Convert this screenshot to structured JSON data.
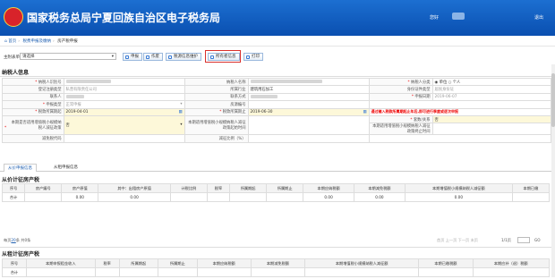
{
  "header": {
    "title": "国家税务总局宁夏回族自治区电子税务局",
    "user_prefix": "您好",
    "logout": "退出"
  },
  "breadcrumb": {
    "home": "首页",
    "module": "税费申报及缴纳",
    "page": "房产税申报"
  },
  "toolbar": {
    "label": "主附表单",
    "select_value": "请选择",
    "buttons": [
      "申报",
      "作废",
      "税源信息维护",
      "所有者信息",
      "打印"
    ]
  },
  "taxpayer": {
    "section_title": "纳税人信息",
    "labels": {
      "taxpayer_id": "纳税人识别号",
      "taxpayer_name": "纳税人名称",
      "taxpayer_category": "纳税人分类",
      "reg_type": "登记注册类型",
      "industry": "所属行业",
      "id_type": "身份证件类型",
      "contact": "联系人",
      "contact_phone": "联系方式",
      "filing_date": "申报日期",
      "reporter_type": "申报类型",
      "property_id": "房源编号",
      "period_start": "税款所属期起",
      "period_end": "税款所属期止",
      "hint": "通过输入税款所属期起止年后,即可进行季度或逐次申报",
      "relation": "套数/关系",
      "reduce_apply": "本期是否适用增值税小规模纳税人减征政策",
      "reduce_start": "本期适用增值税小规模纳税人减征政策起始时间",
      "reduce_end": "本期适用增值税小规模纳税人减征政策终止时间",
      "reduce_code": "减免税代码",
      "reduce_ratio": "减征比例（%）"
    },
    "values": {
      "category_1": "单位",
      "category_2": "个人",
      "reg_type": "私营有限责任公司",
      "industry": "建筑用石加工",
      "id_type": "居民身份证",
      "filing_date": "2019-06-07",
      "reporter_type": "正常申报",
      "period_start": "2019-04-01",
      "period_end": "2019-06-30",
      "relation": "是",
      "reduce_apply": "否",
      "relation_other": "否"
    }
  },
  "tabs": [
    "从价申报信息",
    "从租申报信息"
  ],
  "price_section": {
    "title": "从价计征房产税",
    "headers": [
      "序号",
      "房产编号",
      "房产原值",
      "其中：出租房产原值",
      "计税比例",
      "税率",
      "所属期起",
      "所属期止",
      "本期应纳税额",
      "本期减免税额",
      "本期增值税小规模纳税人减征额",
      "本期已缴"
    ],
    "total_label": "合计",
    "totals": [
      "0.00",
      "0.00",
      "0.00",
      "0.00",
      "0.00"
    ]
  },
  "pager": {
    "size": "20",
    "per_page": "每页",
    "unit": "条",
    "total": "共0条",
    "first": "首页",
    "prev": "上一页",
    "next": "下一页",
    "last": "末页",
    "page": "1/1页",
    "go": "GO"
  },
  "rent_section": {
    "title": "从租计征房产税",
    "headers": [
      "序号",
      "本期申报租金收入",
      "税率",
      "所属期起",
      "所属期止",
      "本期应纳税额",
      "本期减免税额",
      "本期增值税小规模纳税人减征额",
      "本期已缴税额",
      "本期应补（退）税额"
    ],
    "first_cell": "合计"
  },
  "colors": {
    "header": "#0a4fb0",
    "highlight": "#d9302c",
    "required": "#e00000"
  }
}
